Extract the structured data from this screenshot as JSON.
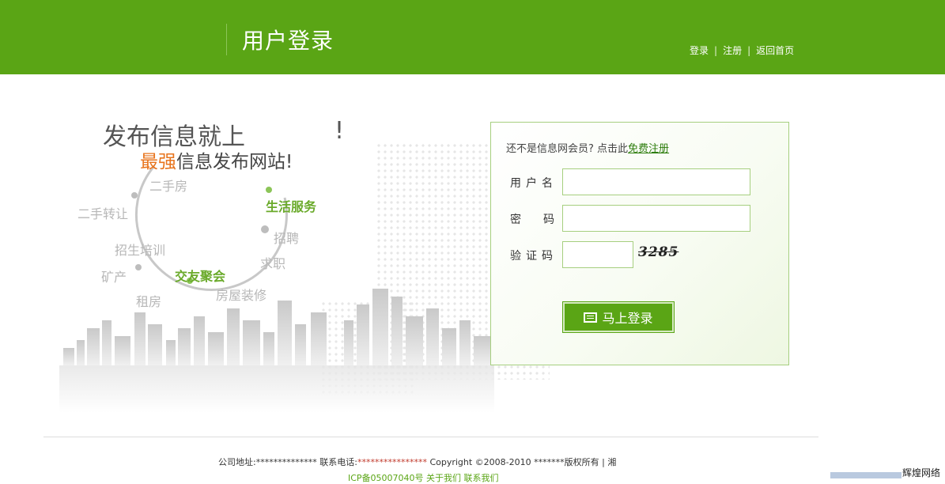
{
  "header": {
    "title": "用户登录",
    "nav": {
      "login": "登录",
      "register": "注册",
      "home": "返回首页",
      "separator": "|"
    }
  },
  "promo": {
    "headline": "发布信息就上",
    "exclaim": "!",
    "sub_highlight": "最强",
    "sub_rest": "信息发布网站!",
    "tags": {
      "secondhand_house": "二手房",
      "transfer": "二手转让",
      "training": "招生培训",
      "mine": "矿产",
      "rent": "租房",
      "social": "交友聚会",
      "decoration": "房屋装修",
      "job_seek": "求职",
      "recruit": "招聘",
      "life_service": "生活服务"
    }
  },
  "login": {
    "prompt": "还不是信息网会员? 点击此",
    "register_link": "免费注册",
    "username_label": "用户名",
    "password_label": "密码",
    "captcha_label": "验证码",
    "username_value": "",
    "password_value": "",
    "captcha_value": "",
    "captcha_image_text": "3285",
    "submit_label": "马上登录"
  },
  "footer": {
    "address_label": "公司地址:",
    "address_value": "**************",
    "phone_label": "联系电话:",
    "phone_value": "****************",
    "copyright": "Copyright ©2008-2010 *******版权所有 | 湘",
    "line2": "ICP备05007040号    关于我们     联系我们"
  },
  "watermark": "辉煌网络",
  "colors": {
    "brand_green": "#5aa515",
    "accent_orange": "#e8741d",
    "border_green": "#a6cf7f"
  }
}
